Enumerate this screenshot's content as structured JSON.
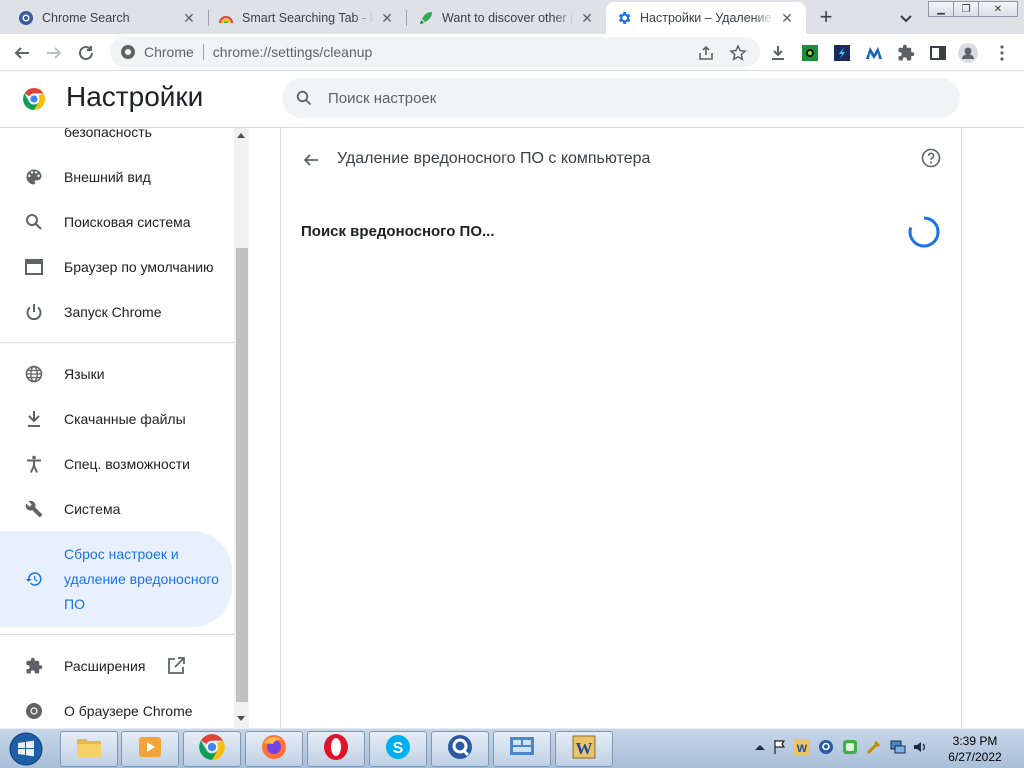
{
  "tabs": [
    {
      "title": "Chrome Search",
      "favicon": "chrome-search-icon",
      "active": false
    },
    {
      "title": "Smart Searching Tab - Ин",
      "favicon": "rainbow-icon",
      "active": false
    },
    {
      "title": "Want to discover other p",
      "favicon": "rocket-icon",
      "active": false
    },
    {
      "title": "Настройки – Удаление в",
      "favicon": "settings-gear-icon",
      "active": true
    }
  ],
  "omnibox": {
    "site_label": "Chrome",
    "url": "chrome://settings/cleanup"
  },
  "header": {
    "title": "Настройки",
    "search_placeholder": "Поиск настроек"
  },
  "sidebar": {
    "items": [
      {
        "label": "безопасность",
        "icon": "shield-icon"
      },
      {
        "label": "Внешний вид",
        "icon": "palette-icon"
      },
      {
        "label": "Поисковая система",
        "icon": "search-icon"
      },
      {
        "label": "Браузер по умолчанию",
        "icon": "browser-window-icon"
      },
      {
        "label": "Запуск Chrome",
        "icon": "power-icon"
      },
      {
        "label": "Языки",
        "icon": "globe-icon"
      },
      {
        "label": "Скачанные файлы",
        "icon": "download-icon"
      },
      {
        "label": "Спец. возможности",
        "icon": "accessibility-icon"
      },
      {
        "label": "Система",
        "icon": "wrench-icon"
      },
      {
        "label": "Сброс настроек и удаление вредоносного ПО",
        "icon": "restore-icon",
        "selected": true
      },
      {
        "label": "Расширения",
        "icon": "puzzle-icon"
      },
      {
        "label": "О браузере Chrome",
        "icon": "chrome-icon"
      }
    ]
  },
  "main": {
    "page_title": "Удаление вредоносного ПО с компьютера",
    "status_label": "Поиск вредоносного ПО..."
  },
  "taskbar": {
    "apps": [
      "file-explorer-icon",
      "media-player-icon",
      "chrome-icon",
      "firefox-icon",
      "opera-icon",
      "skype-icon",
      "quicktime-icon",
      "control-panel-icon",
      "winword-icon"
    ],
    "clock_time": "3:39 PM",
    "clock_date": "6/27/2022"
  },
  "colors": {
    "accent": "#1a73e8",
    "selected_bg": "#e8f0fe",
    "tabstrip_bg": "#dee1e6"
  }
}
